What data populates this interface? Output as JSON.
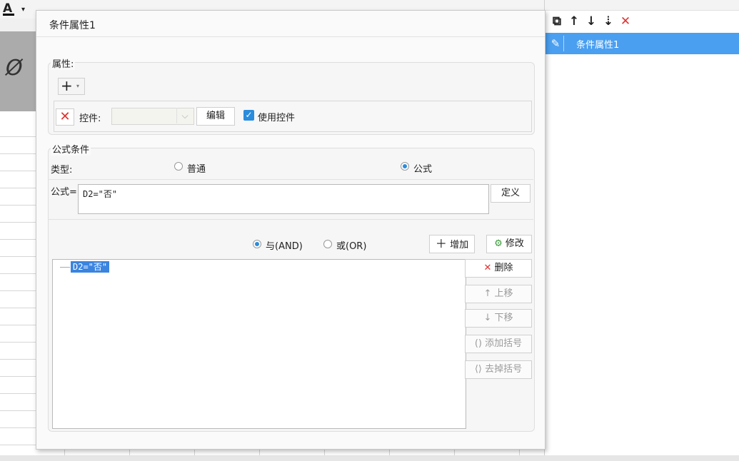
{
  "app": {
    "font_color_icon": "A",
    "hidden_icon": "Ø"
  },
  "right_panel": {
    "toolbar": [
      {
        "name": "copy-icon",
        "glyph": "⧉"
      },
      {
        "name": "arrow-up-icon",
        "glyph": "↑"
      },
      {
        "name": "arrow-down-icon",
        "glyph": "↓"
      },
      {
        "name": "sort-down-icon",
        "glyph": "⇣"
      },
      {
        "name": "delete-icon",
        "glyph": "✕"
      }
    ],
    "items": [
      {
        "label": "条件属性1",
        "icon": "pencil-icon",
        "selected": true
      }
    ]
  },
  "dialog": {
    "title": "条件属性1",
    "attributes": {
      "label": "属性:",
      "add_icon": "+",
      "widget_label": "控件:",
      "widget_value": "",
      "edit_label": "编辑",
      "use_widget_label": "使用控件",
      "use_widget_checked": true
    },
    "formula_condition": {
      "label": "公式条件",
      "type_label": "类型:",
      "type_options": [
        "普通",
        "公式"
      ],
      "type_selected": "公式",
      "formula_label": "公式=",
      "formula_value": "D2=\"否\"",
      "define_label": "定义",
      "logic_options": [
        "与(AND)",
        "或(OR)"
      ],
      "logic_selected": "与(AND)",
      "add_label": "增加",
      "modify_label": "修改",
      "conditions": [
        "D2=\"否\""
      ],
      "delete_label": "删除",
      "move_up_label": "上移",
      "move_down_label": "下移",
      "add_paren_label": "添加括号",
      "remove_paren_label": "去掉括号"
    }
  },
  "colors": {
    "accent": "#2a8cdc",
    "selection": "#4a9ff0",
    "danger": "#e0322f"
  }
}
